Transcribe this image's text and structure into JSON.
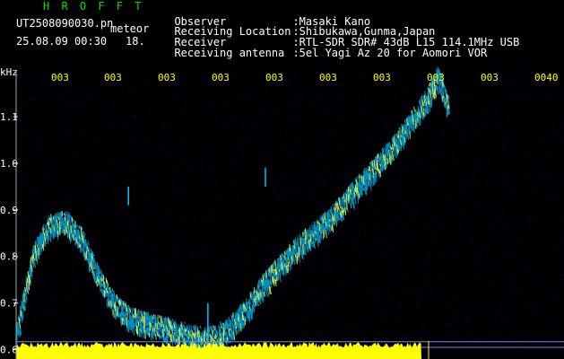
{
  "header": {
    "station_logo": "H R O F F T",
    "filename": "UT2508090030.pn",
    "suffix_tag": "meteor",
    "date_time": "25.08.09 00:30",
    "counter": "18.",
    "fields": [
      {
        "key": "Observer",
        "value": ":Masaki Kano"
      },
      {
        "key": "Receiving Location",
        "value": ":Shibukawa,Gunma,Japan"
      },
      {
        "key": "Receiver",
        "value": ":RTL-SDR SDR# 43dB L15 114.1MHz USB"
      },
      {
        "key": "Receiving antenna",
        "value": ":5el Yagi Az 20 for Aomori VOR"
      }
    ]
  },
  "colors": {
    "header_logo": "#00e000",
    "header_text": "#ffffff",
    "time_labels": "#ffff00",
    "axis_text": "#ffffff",
    "background": "#000000",
    "noise": "#000060",
    "signal_trace": "#00c0ff",
    "signal_hot": "#ffff40",
    "level_bar": "#ffff00"
  },
  "chart_data": {
    "type": "heatmap",
    "y_unit": "kHz",
    "y_ticks": [
      "1.1",
      "1.0",
      "0.9",
      "0.8",
      "0.7",
      "0.6"
    ],
    "ylim": [
      0.58,
      1.2
    ],
    "x_ticks": [
      "003",
      "003",
      "003",
      "003",
      "003",
      "003",
      "003",
      "003",
      "003",
      "0040"
    ],
    "xlim": [
      0,
      10
    ],
    "trace": {
      "x": [
        0.0,
        0.3,
        0.6,
        0.9,
        1.2,
        1.5,
        1.8,
        2.1,
        2.4,
        2.7,
        3.0,
        3.3,
        3.6,
        3.9,
        4.2,
        4.5,
        4.8,
        5.1,
        5.4,
        5.7,
        6.0,
        6.3,
        6.6,
        6.9,
        7.2,
        7.5,
        7.7,
        7.9
      ],
      "y": [
        0.63,
        0.8,
        0.87,
        0.88,
        0.84,
        0.76,
        0.7,
        0.67,
        0.66,
        0.65,
        0.64,
        0.63,
        0.63,
        0.65,
        0.69,
        0.74,
        0.78,
        0.82,
        0.85,
        0.88,
        0.92,
        0.96,
        1.0,
        1.04,
        1.09,
        1.14,
        1.19,
        1.12
      ]
    },
    "meteor_echoes": [
      {
        "x": 2.05,
        "y_from": 0.91,
        "y_to": 0.95
      },
      {
        "x": 4.55,
        "y_from": 0.95,
        "y_to": 0.99
      },
      {
        "x": 3.5,
        "y_from": 0.58,
        "y_to": 0.7
      }
    ],
    "reference_lines_khz": [
      0.617,
      0.605
    ]
  }
}
